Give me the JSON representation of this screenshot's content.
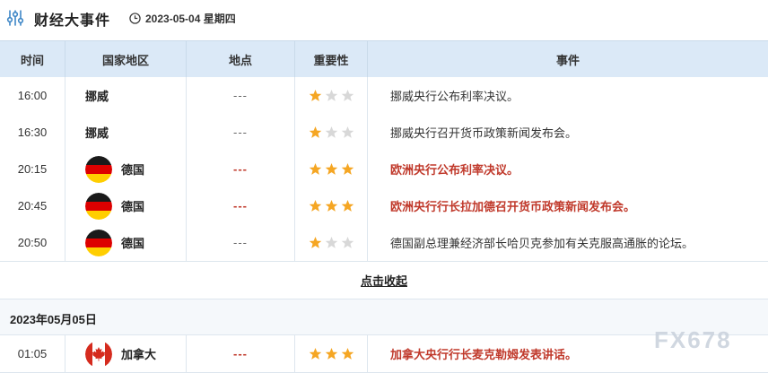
{
  "header": {
    "title": "财经大事件",
    "date": "2023-05-04 星期四"
  },
  "columns": {
    "time": "时间",
    "region": "国家地区",
    "place": "地点",
    "importance": "重要性",
    "event": "事件"
  },
  "rows": [
    {
      "time": "16:00",
      "region": "挪威",
      "flag": "none",
      "place": "---",
      "stars": 1,
      "event": "挪威央行公布利率决议。",
      "highlight": false
    },
    {
      "time": "16:30",
      "region": "挪威",
      "flag": "none",
      "place": "---",
      "stars": 1,
      "event": "挪威央行召开货币政策新闻发布会。",
      "highlight": false
    },
    {
      "time": "20:15",
      "region": "德国",
      "flag": "germany-flag",
      "place": "---",
      "stars": 3,
      "event": "欧洲央行公布利率决议。",
      "highlight": true
    },
    {
      "time": "20:45",
      "region": "德国",
      "flag": "germany-flag",
      "place": "---",
      "stars": 3,
      "event": "欧洲央行行长拉加德召开货币政策新闻发布会。",
      "highlight": true
    },
    {
      "time": "20:50",
      "region": "德国",
      "flag": "germany-flag",
      "place": "---",
      "stars": 1,
      "event": "德国副总理兼经济部长哈贝克参加有关克服高通胀的论坛。",
      "highlight": false
    }
  ],
  "collapse_label": "点击收起",
  "next_date": "2023年05月05日",
  "next_rows": [
    {
      "time": "01:05",
      "region": "加拿大",
      "flag": "canada-flag",
      "place": "---",
      "stars": 3,
      "event": "加拿大央行行长麦克勒姆发表讲话。",
      "highlight": true
    }
  ],
  "watermark": "FX678",
  "colors": {
    "header_bg": "#dbe9f7",
    "highlight": "#c0392b",
    "star_on": "#f5a623",
    "star_off": "#d8d8d8"
  }
}
